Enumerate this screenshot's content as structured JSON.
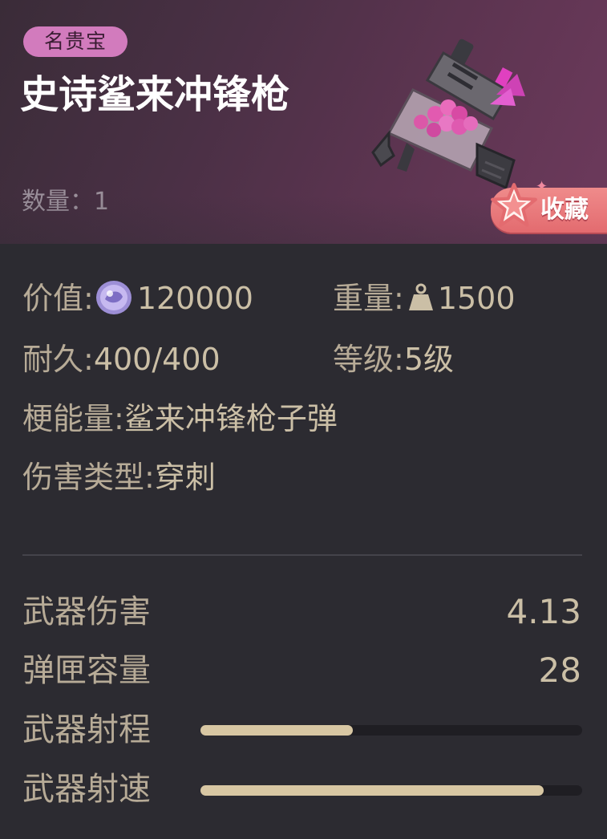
{
  "item": {
    "rarity": "名贵宝",
    "name": "史诗鲨来冲锋枪",
    "quantity_label": "数量：",
    "quantity": "1",
    "favorite_label": "收藏"
  },
  "attributes": {
    "value_label": "价值:",
    "value": "120000",
    "weight_label": "重量:",
    "weight": "1500",
    "durability_label": "耐久:",
    "durability": "400/400",
    "level_label": "等级:",
    "level": "5级",
    "ammo_label": "梗能量:",
    "ammo": "鲨来冲锋枪子弹",
    "damage_type_label": "伤害类型:",
    "damage_type": "穿刺"
  },
  "stats": {
    "damage_label": "武器伤害",
    "damage_value": "4.13",
    "magazine_label": "弹匣容量",
    "magazine_value": "28",
    "range_label": "武器射程",
    "range_fraction": 0.4,
    "fire_rate_label": "武器射速",
    "fire_rate_fraction": 0.9
  },
  "colors": {
    "rarity_badge": "#d27bbd",
    "bar_fill": "#d8c7a3",
    "favorite": "#e36b6f"
  },
  "icons": {
    "currency": "coin-icon",
    "weight": "weight-icon",
    "favorite": "star-icon"
  }
}
